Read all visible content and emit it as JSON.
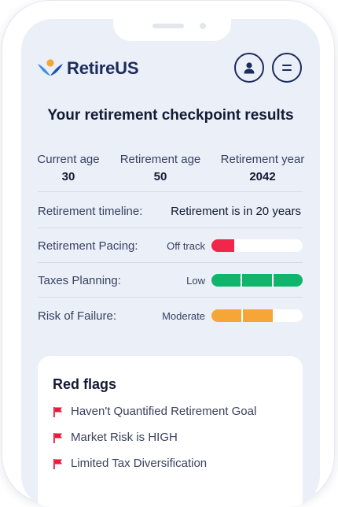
{
  "brand": {
    "name": "RetireUS",
    "accent": "#1d2b5c"
  },
  "header": {
    "user_icon": "user-icon",
    "menu_icon": "menu-icon"
  },
  "title": "Your retirement checkpoint results",
  "stats": [
    {
      "label": "Current age",
      "value": "30"
    },
    {
      "label": "Retirement age",
      "value": "50"
    },
    {
      "label": "Retirement year",
      "value": "2042"
    }
  ],
  "rows": [
    {
      "label": "Retirement timeline:",
      "value": "Retirement is in 20 years"
    },
    {
      "label": "Retirement Pacing:",
      "status": "Off track",
      "color": "#f0264b",
      "filled_segments": 1,
      "total_segments": 4
    },
    {
      "label": "Taxes Planning:",
      "status": "Low",
      "color": "#10b46b",
      "filled_segments": 3,
      "total_segments": 3
    },
    {
      "label": "Risk of Failure:",
      "status": "Moderate",
      "color": "#f5a636",
      "filled_segments": 2,
      "total_segments": 3
    }
  ],
  "red_flags": {
    "title": "Red flags",
    "icon": "red-flag-icon",
    "color": "#e8193c",
    "items": [
      "Haven't Quantified Retirement Goal",
      "Market Risk is HIGH",
      "Limited Tax Diversification"
    ]
  }
}
